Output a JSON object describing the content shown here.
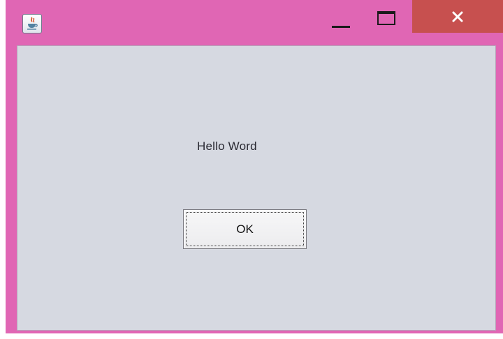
{
  "window": {
    "title": "",
    "frame_color": "#e066b4",
    "close_color": "#c7504f",
    "icon": "java-cup-icon"
  },
  "titlebar_controls": {
    "minimize_icon": "minimize-icon",
    "maximize_icon": "maximize-icon",
    "close_icon": "close-icon"
  },
  "content": {
    "label_text": "Hello Word",
    "ok_button_label": "OK"
  }
}
